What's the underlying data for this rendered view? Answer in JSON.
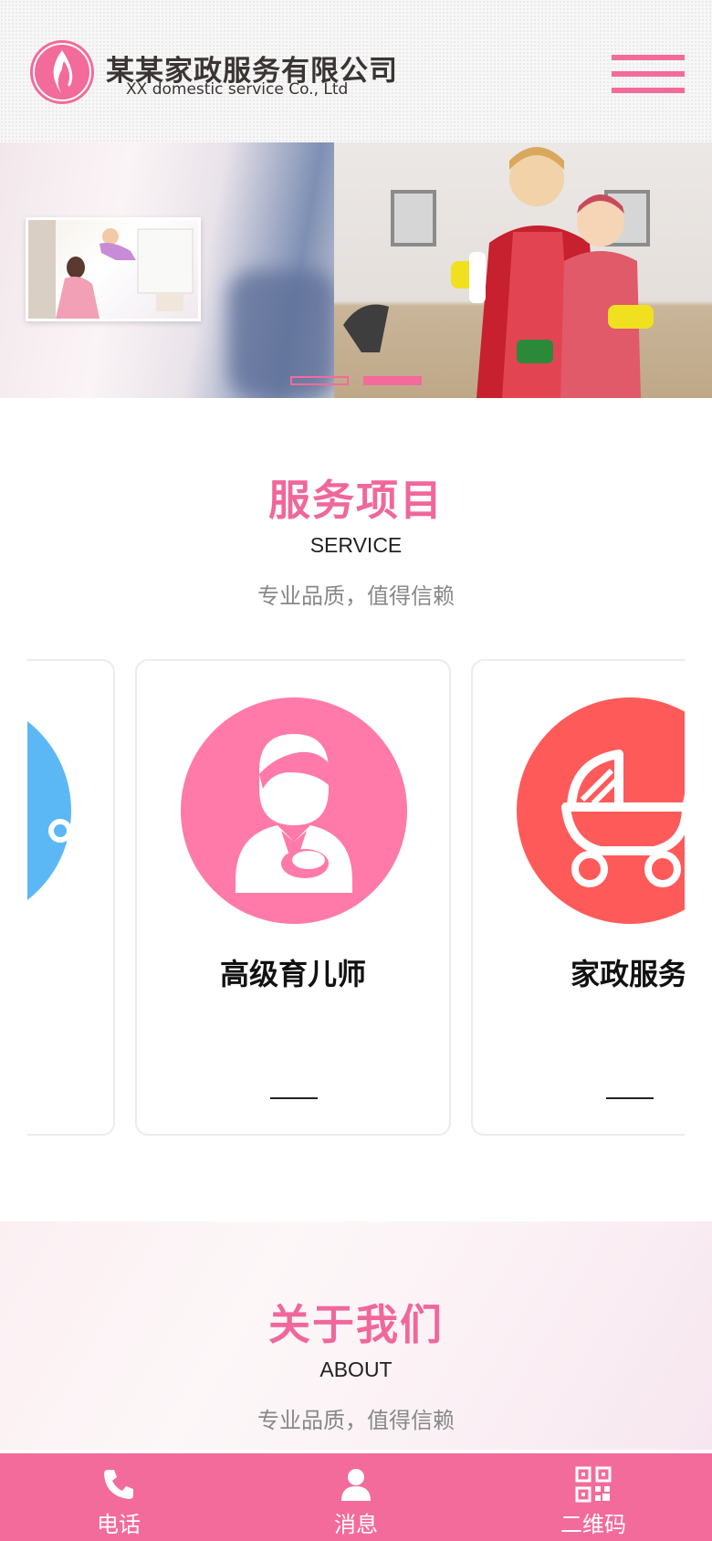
{
  "header": {
    "company_name_cn": "某某家政服务有限公司",
    "company_name_en": "XX domestic service Co., Ltd",
    "accent_color": "#f36b9a"
  },
  "banner": {
    "slide_count": 2,
    "active_slide": 2
  },
  "service": {
    "title_cn": "服务项目",
    "title_en": "SERVICE",
    "subtitle": "专业品质，值得信赖",
    "cards": [
      {
        "name": "",
        "icon": "nanny-icon",
        "color": "#5cb8f5"
      },
      {
        "name": "高级育儿师",
        "icon": "childcare-specialist-icon",
        "color": "#ff7aa8"
      },
      {
        "name": "家政服务",
        "icon": "baby-stroller-icon",
        "color": "#ff5a5a"
      }
    ]
  },
  "about": {
    "title_cn": "关于我们",
    "title_en": "ABOUT",
    "subtitle": "专业品质，值得信赖"
  },
  "bottom_nav": {
    "items": [
      {
        "label": "电话",
        "icon": "phone-icon"
      },
      {
        "label": "消息",
        "icon": "user-message-icon"
      },
      {
        "label": "二维码",
        "icon": "qr-code-icon"
      }
    ]
  }
}
